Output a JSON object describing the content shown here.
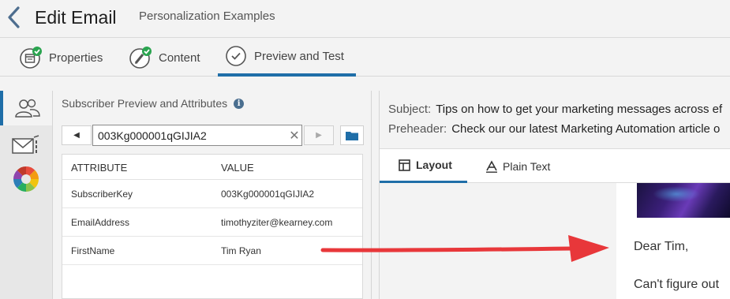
{
  "header": {
    "title": "Edit Email",
    "subtitle": "Personalization Examples"
  },
  "tabs": [
    {
      "label": "Properties",
      "icon": "properties-icon",
      "state": "complete"
    },
    {
      "label": "Content",
      "icon": "content-edit-icon",
      "state": "complete"
    },
    {
      "label": "Preview and Test",
      "icon": "check-circle-icon",
      "state": "active"
    }
  ],
  "rail": [
    {
      "icon": "subscribers-icon",
      "active": true
    },
    {
      "icon": "email-test-icon",
      "active": false
    },
    {
      "icon": "color-wheel-icon",
      "active": false
    }
  ],
  "panel": {
    "title": "Subscriber Preview and Attributes",
    "search_value": "003Kg000001qGIJIA2",
    "columns": [
      "ATTRIBUTE",
      "VALUE"
    ],
    "rows": [
      {
        "attribute": "SubscriberKey",
        "value": "003Kg000001qGIJIA2"
      },
      {
        "attribute": "EmailAddress",
        "value": "timothyziter@kearney.com"
      },
      {
        "attribute": "FirstName",
        "value": "Tim Ryan"
      }
    ]
  },
  "preview": {
    "subject_label": "Subject:",
    "subject": "Tips on how to get your marketing messages across ef",
    "preheader_label": "Preheader:",
    "preheader": "Check our our latest Marketing Automation article o",
    "tabs": [
      {
        "label": "Layout",
        "active": true
      },
      {
        "label": "Plain Text",
        "active": false
      }
    ],
    "greeting": "Dear Tim,",
    "body_start": "Can't figure out"
  },
  "colors": {
    "accent": "#1f6ea8",
    "success": "#2aa44f",
    "annotation_arrow": "#e8373a"
  }
}
